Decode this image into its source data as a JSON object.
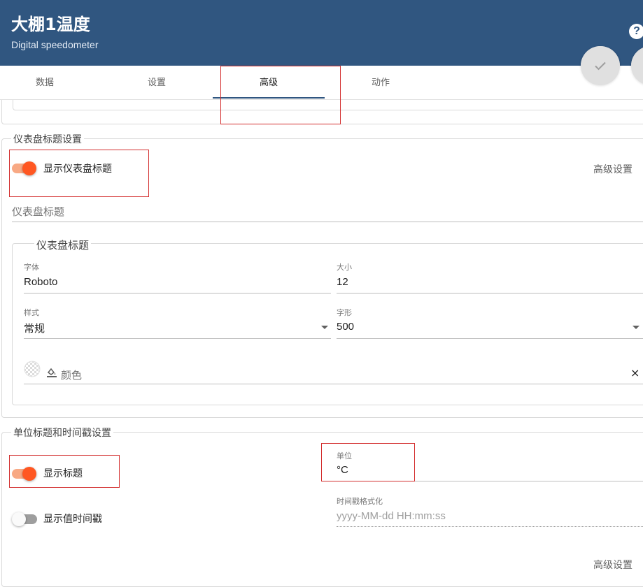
{
  "header": {
    "title": "大棚1温度",
    "subtitle": "Digital speedometer",
    "help_glyph": "?",
    "background_color": "#305680"
  },
  "tabs": [
    {
      "label": "数据",
      "active": false
    },
    {
      "label": "设置",
      "active": false
    },
    {
      "label": "高级",
      "active": true
    },
    {
      "label": "动作",
      "active": false
    }
  ],
  "dashboard_title_section": {
    "legend": "仪表盘标题设置",
    "toggle_label": "显示仪表盘标题",
    "toggle_on": true,
    "advanced_label": "高级设置",
    "title_input_placeholder": "仪表盘标题",
    "font_group": {
      "legend": "仪表盘标题",
      "font_label": "字体",
      "font_value": "Roboto",
      "size_label": "大小",
      "size_value": "12",
      "style_label": "样式",
      "style_value": "常规",
      "weight_label": "字形",
      "weight_value": "500",
      "color_placeholder": "颜色",
      "clear_glyph": "×"
    }
  },
  "unit_section": {
    "legend": "单位标题和时间戳设置",
    "show_title_label": "显示标题",
    "show_title_on": true,
    "show_timestamp_label": "显示值时间戳",
    "show_timestamp_on": false,
    "unit_label": "单位",
    "unit_value": "°C",
    "timestamp_format_label": "时间戳格式化",
    "timestamp_format_placeholder": "yyyy-MM-dd HH:mm:ss",
    "advanced_label": "高级设置"
  },
  "colors": {
    "accent": "#ff5722",
    "tab_indicator": "#305680",
    "highlight_box": "#d32f2f"
  },
  "icons": [
    "check-icon",
    "close-icon",
    "help-icon",
    "checkerboard-icon",
    "format-color-fill-icon",
    "dropdown-caret-icon"
  ]
}
